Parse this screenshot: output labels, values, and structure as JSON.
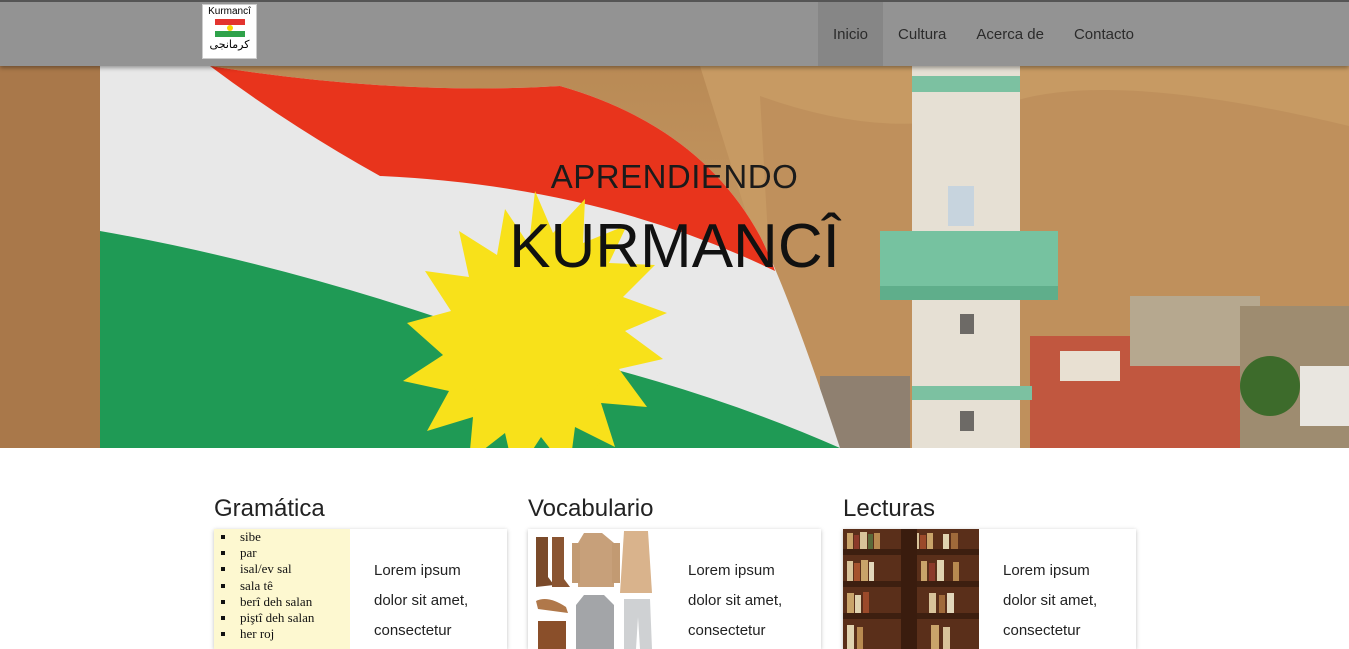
{
  "logo": {
    "top_text": "Kurmancî",
    "bottom_text": "کرمانجی"
  },
  "nav": {
    "items": [
      {
        "label": "Inicio",
        "active": true
      },
      {
        "label": "Cultura",
        "active": false
      },
      {
        "label": "Acerca de",
        "active": false
      },
      {
        "label": "Contacto",
        "active": false
      }
    ]
  },
  "hero": {
    "subtitle": "APRENDIENDO",
    "title": "KURMANCÎ"
  },
  "sections": [
    {
      "heading": "Gramática",
      "text": "Lorem ipsum dolor sit amet, consectetur",
      "thumb_list": [
        "sibe",
        "par",
        "isal/ev sal",
        "sala tê",
        "berî deh salan",
        "piştî deh salan",
        "her roj"
      ]
    },
    {
      "heading": "Vocabulario",
      "text": "Lorem ipsum dolor sit amet, consectetur"
    },
    {
      "heading": "Lecturas",
      "text": "Lorem ipsum dolor sit amet, consectetur"
    }
  ],
  "colors": {
    "navbar": "#939393",
    "nav_active": "#868686",
    "flag_red": "#e8341c",
    "flag_white": "#e8e8e8",
    "flag_green": "#1f9a55",
    "flag_sun": "#f8e11a"
  }
}
